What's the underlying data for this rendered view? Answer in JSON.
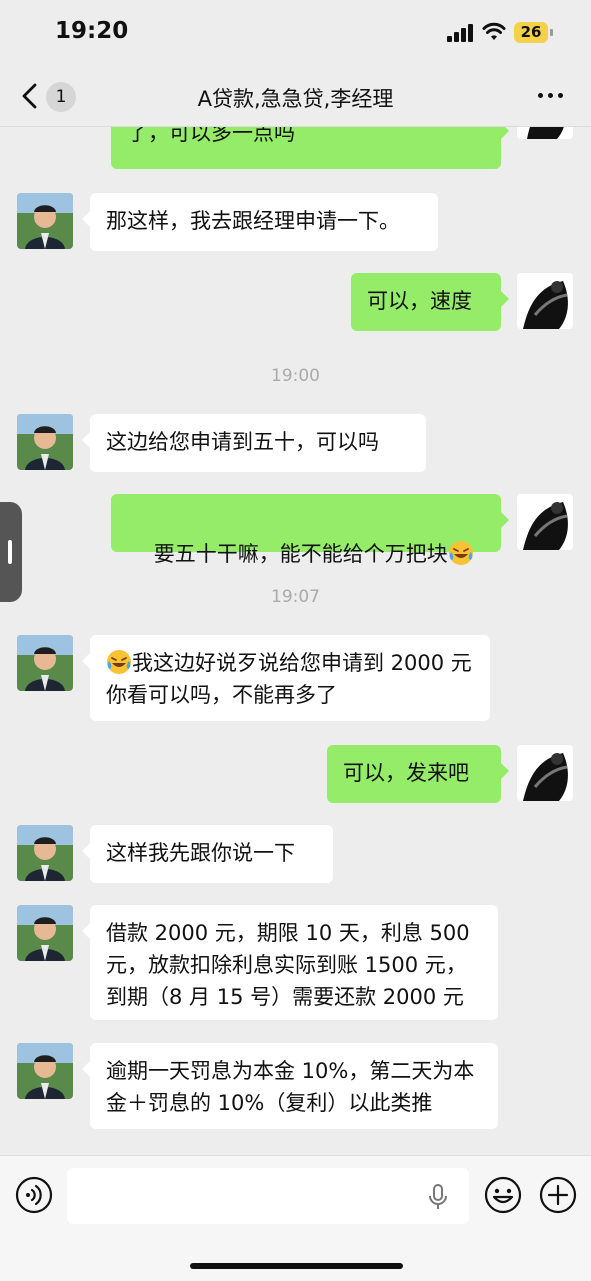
{
  "status": {
    "time": "19:20",
    "battery": "26"
  },
  "header": {
    "unread_count": "1",
    "title": "A贷款,急急贷,李经理"
  },
  "messages": [
    {
      "text": "了，可以多一点吗"
    },
    {
      "text": "那这样，我去跟经理申请一下。"
    },
    {
      "text": "可以，速度"
    },
    {
      "text": "这边给您申请到五十，可以吗"
    },
    {
      "text": "要五十干嘛，能不能给个万把块"
    },
    {
      "text": "我这边好说歹说给您申请到 2000 元你看可以吗，不能再多了"
    },
    {
      "text": "可以，发来吧"
    },
    {
      "text": "这样我先跟你说一下"
    },
    {
      "text": "借款 2000 元，期限 10 天，利息 500 元，放款扣除利息实际到账 1500 元，到期（8 月 15 号）需要还款 2000 元"
    },
    {
      "text": "逾期一天罚息为本金 10%，第二天为本金＋罚息的 10%（复利）以此类推"
    }
  ],
  "timestamps": [
    "19:00",
    "19:07"
  ],
  "icons": {
    "back": "chevron-left-icon",
    "more": "more-dots-icon",
    "voice": "voice-icon",
    "mic": "mic-icon",
    "emoji": "smiley-icon",
    "add": "plus-icon",
    "sweat_emoji": "laughing-tears-emoji"
  },
  "colors": {
    "outgoing_bubble": "#95ec69",
    "incoming_bubble": "#ffffff",
    "background": "#ededed"
  }
}
